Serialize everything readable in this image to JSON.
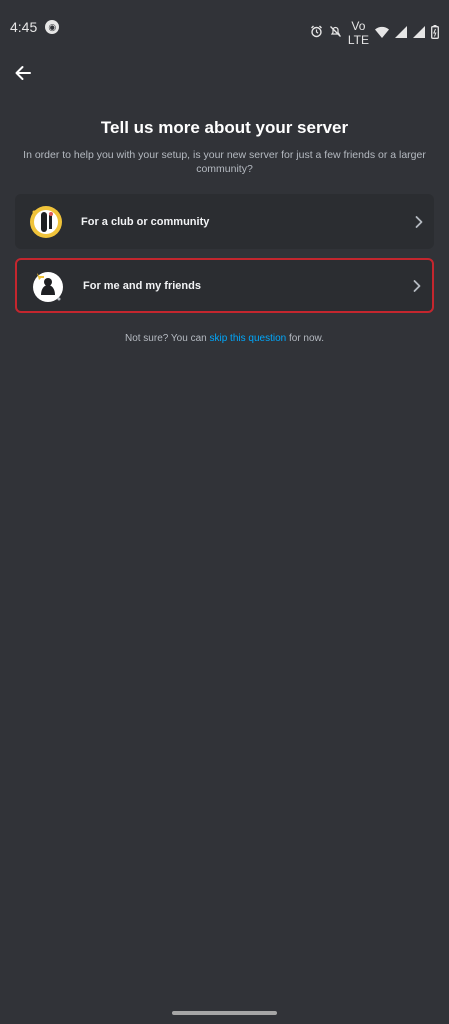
{
  "status_bar": {
    "time": "4:45",
    "volte_line1": "Vo",
    "volte_line2": "LTE"
  },
  "header": {
    "title": "Tell us more about your server",
    "subtitle": "In order to help you with your setup, is your new server for just a few friends or a larger community?"
  },
  "options": [
    {
      "label": "For a club or community",
      "icon": "club-illustration-icon"
    },
    {
      "label": "For me and my friends",
      "icon": "friends-illustration-icon"
    }
  ],
  "skip": {
    "prefix": "Not sure? You can ",
    "link": "skip this question",
    "suffix": " for now."
  },
  "colors": {
    "background": "#313338",
    "card": "#2b2d31",
    "link": "#00a8fc",
    "highlight_border": "#c4262e"
  }
}
